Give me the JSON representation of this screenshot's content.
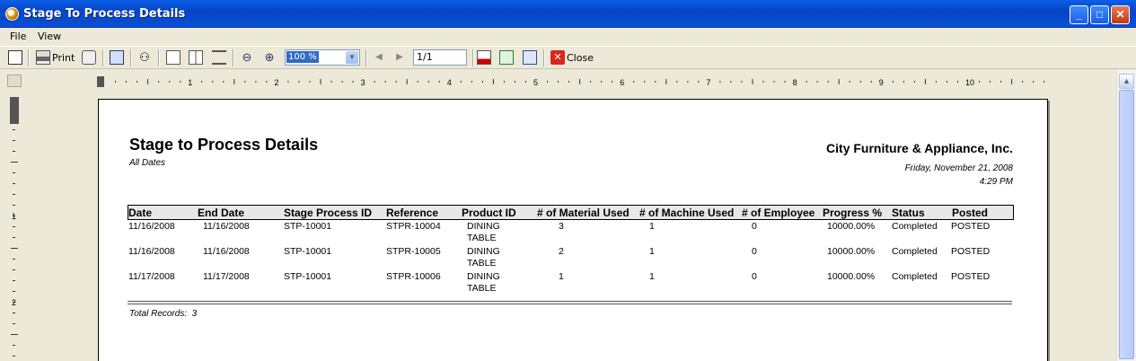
{
  "window": {
    "title": "Stage To Process Details"
  },
  "menu": [
    "File",
    "View"
  ],
  "toolbar": {
    "print_label": "Print",
    "zoom_value": "100 %",
    "page_value": "1/1",
    "close_label": "Close"
  },
  "ruler": {
    "numbers": [
      "1",
      "2",
      "3",
      "4",
      "5",
      "6",
      "7",
      "8",
      "9",
      "10"
    ],
    "vertical_numbers": [
      "1",
      "2"
    ]
  },
  "report": {
    "title": "Stage to Process Details",
    "subtitle": "All Dates",
    "company": "City Furniture & Appliance, Inc.",
    "date": "Friday, November 21, 2008",
    "time": "4:29 PM",
    "columns": [
      "Date",
      "End Date",
      "Stage Process ID",
      "Reference",
      "Product ID",
      "# of Material Used",
      "# of Machine Used",
      "# of Employee",
      "Progress %",
      "Status",
      "Posted"
    ],
    "rows": [
      {
        "date": "11/16/2008",
        "end_date": "11/16/2008",
        "stage_process_id": "STP-10001",
        "reference": "STPR-10004",
        "product_line1": "DINING",
        "product_line2": "TABLE",
        "material": "3",
        "machine": "1",
        "employee": "0",
        "progress": "10000.00%",
        "status": "Completed",
        "posted": "POSTED"
      },
      {
        "date": "11/16/2008",
        "end_date": "11/16/2008",
        "stage_process_id": "STP-10001",
        "reference": "STPR-10005",
        "product_line1": "DINING",
        "product_line2": "TABLE",
        "material": "2",
        "machine": "1",
        "employee": "0",
        "progress": "10000.00%",
        "status": "Completed",
        "posted": "POSTED"
      },
      {
        "date": "11/17/2008",
        "end_date": "11/17/2008",
        "stage_process_id": "STP-10001",
        "reference": "STPR-10006",
        "product_line1": "DINING",
        "product_line2": "TABLE",
        "material": "1",
        "machine": "1",
        "employee": "0",
        "progress": "10000.00%",
        "status": "Completed",
        "posted": "POSTED"
      }
    ],
    "total_label": "Total Records:",
    "total_value": "3"
  }
}
